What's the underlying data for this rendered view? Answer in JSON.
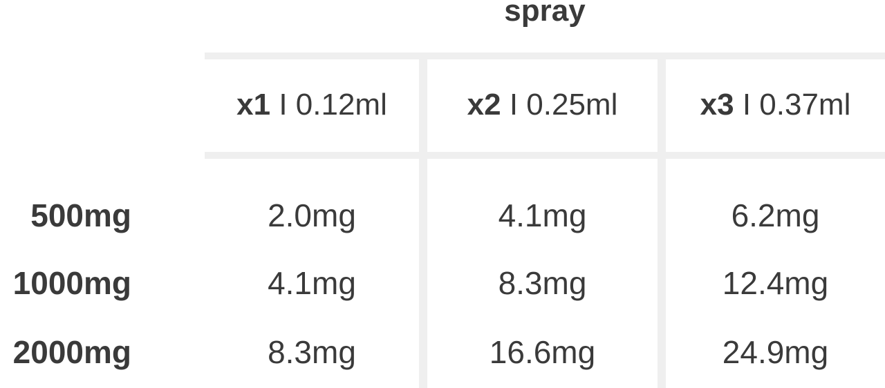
{
  "table": {
    "title": "spray",
    "columns": [
      {
        "multiplier": "x1",
        "separator": "I",
        "volume": "0.12ml"
      },
      {
        "multiplier": "x2",
        "separator": "I",
        "volume": "0.25ml"
      },
      {
        "multiplier": "x3",
        "separator": "I",
        "volume": "0.37ml"
      }
    ],
    "rows": [
      {
        "label": "500mg",
        "cells": [
          "2.0mg",
          "4.1mg",
          "6.2mg"
        ]
      },
      {
        "label": "1000mg",
        "cells": [
          "4.1mg",
          "8.3mg",
          "12.4mg"
        ]
      },
      {
        "label": "2000mg",
        "cells": [
          "8.3mg",
          "16.6mg",
          "24.9mg"
        ]
      }
    ]
  }
}
